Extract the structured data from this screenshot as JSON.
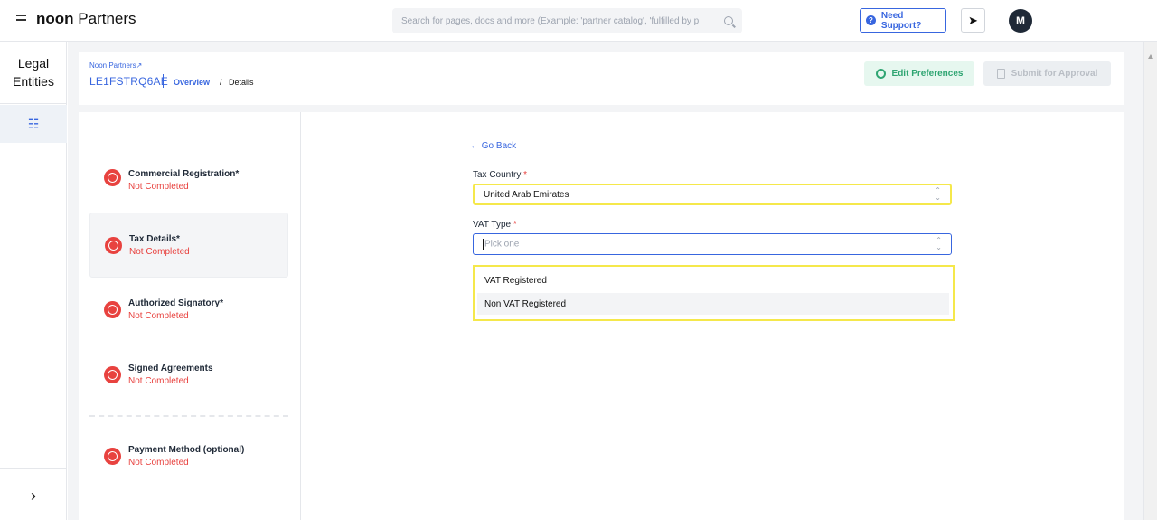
{
  "header": {
    "logo_bold": "noon",
    "logo_text": " Partners",
    "search_placeholder": "Search for pages, docs and more (Example: 'partner catalog', 'fulfilled by p",
    "support_label": "Need Support?",
    "avatar_initial": "M"
  },
  "rail": {
    "title_line1": "Legal",
    "title_line2": "Entities",
    "expand_icon": "chevron-right-icon"
  },
  "breadcrumb": {
    "partner_link": "Noon Partners",
    "entity_id": "LE1FSTRQ6AE",
    "overview": "Overview",
    "separator": "/",
    "current": "Details"
  },
  "actions": {
    "edit_preferences": "Edit Preferences",
    "submit_for_approval": "Submit for Approval"
  },
  "steps": [
    {
      "title": "Commercial Registration*",
      "status": "Not Completed"
    },
    {
      "title": "Tax Details*",
      "status": "Not Completed"
    },
    {
      "title": "Authorized Signatory*",
      "status": "Not Completed"
    },
    {
      "title": "Signed Agreements",
      "status": "Not Completed"
    },
    {
      "title": "Payment Method (optional)",
      "status": "Not Completed"
    }
  ],
  "form": {
    "go_back": "← Go Back",
    "tax_country_label": "Tax Country",
    "tax_country_value": "United Arab Emirates",
    "vat_type_label": "VAT Type",
    "vat_type_placeholder": "Pick one",
    "required_marker": "*",
    "vat_options": [
      "VAT Registered",
      "Non VAT Registered"
    ]
  },
  "colors": {
    "accent": "#3866df",
    "error": "#e8423f",
    "success": "#2fa572",
    "highlight": "#f5e84b"
  }
}
